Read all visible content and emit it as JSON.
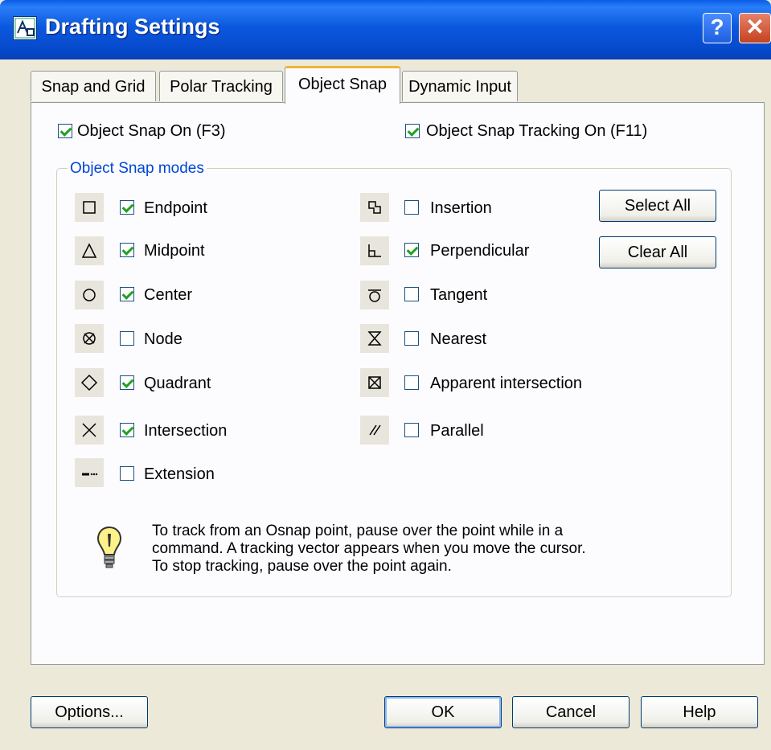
{
  "window": {
    "title": "Drafting Settings",
    "help_glyph": "?",
    "close_glyph": "✕"
  },
  "tabs": [
    {
      "label": "Snap and Grid",
      "active": false
    },
    {
      "label": "Polar Tracking",
      "active": false
    },
    {
      "label": "Object Snap",
      "active": true
    },
    {
      "label": "Dynamic Input",
      "active": false
    }
  ],
  "object_snap_on": {
    "label": "Object Snap On (F3)",
    "checked": true
  },
  "tracking_on": {
    "label": "Object Snap Tracking On (F11)",
    "checked": true
  },
  "modes_group": {
    "title": "Object Snap modes",
    "left_column": [
      {
        "label": "Endpoint",
        "checked": true,
        "icon": "endpoint-icon"
      },
      {
        "label": "Midpoint",
        "checked": true,
        "icon": "midpoint-icon"
      },
      {
        "label": "Center",
        "checked": true,
        "icon": "center-icon"
      },
      {
        "label": "Node",
        "checked": false,
        "icon": "node-icon"
      },
      {
        "label": "Quadrant",
        "checked": true,
        "icon": "quadrant-icon"
      },
      {
        "label": "Intersection",
        "checked": true,
        "icon": "intersection-icon"
      },
      {
        "label": "Extension",
        "checked": false,
        "icon": "extension-icon"
      }
    ],
    "right_column": [
      {
        "label": "Insertion",
        "checked": false,
        "icon": "insertion-icon"
      },
      {
        "label": "Perpendicular",
        "checked": true,
        "icon": "perpendicular-icon"
      },
      {
        "label": "Tangent",
        "checked": false,
        "icon": "tangent-icon"
      },
      {
        "label": "Nearest",
        "checked": false,
        "icon": "nearest-icon"
      },
      {
        "label": "Apparent intersection",
        "checked": false,
        "icon": "apparent-intersection-icon"
      },
      {
        "label": "Parallel",
        "checked": false,
        "icon": "parallel-icon"
      }
    ],
    "select_all": "Select All",
    "clear_all": "Clear All",
    "tip_lines": [
      "To track from an Osnap point, pause over the point while in a",
      "command.  A tracking vector appears when you move the cursor.",
      "To stop tracking, pause over the point again."
    ]
  },
  "buttons": {
    "options": "Options...",
    "ok": "OK",
    "cancel": "Cancel",
    "help": "Help"
  }
}
